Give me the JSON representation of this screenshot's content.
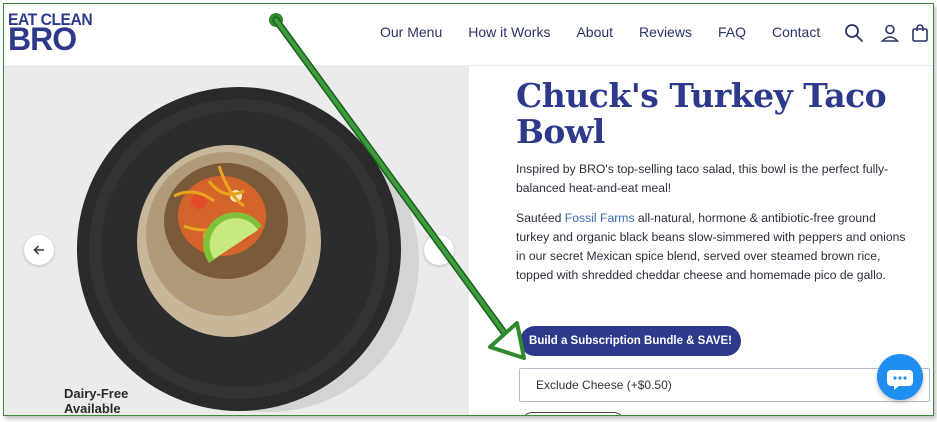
{
  "brand": {
    "logo_line1": "EAT CLEAN",
    "logo_line2": "BRO",
    "color": "#2d3a8c"
  },
  "nav": {
    "items": [
      {
        "label": "Our Menu"
      },
      {
        "label": "How it Works"
      },
      {
        "label": "About"
      },
      {
        "label": "Reviews"
      },
      {
        "label": "FAQ"
      },
      {
        "label": "Contact"
      }
    ],
    "icons": [
      "search-icon",
      "account-icon",
      "cart-icon"
    ]
  },
  "gallery": {
    "prev_icon": "arrow-left-icon",
    "badge_line1": "Dairy-Free",
    "badge_line2": "Available"
  },
  "product": {
    "title": "Chuck's Turkey Taco Bowl",
    "intro": "Inspired by BRO's top-selling taco salad, this bowl is the perfect fully-balanced heat-and-eat meal!",
    "desc_before_link": "Sautéed ",
    "desc_link": "Fossil Farms",
    "desc_after_link": " all-natural, hormone & antibiotic-free ground turkey and organic black beans slow-simmered with peppers and onions in our secret Mexican spice blend, served over steamed brown rice, topped with shredded cheddar cheese and homemade pico de gallo.",
    "subscription_button": "Build a Subscription Bundle & SAVE!",
    "option_label": "Exclude Cheese (+$0.50)"
  },
  "chat": {
    "icon": "chat-icon",
    "color": "#1f8ef1"
  },
  "annotation": {
    "color": "#2f8a2f"
  }
}
